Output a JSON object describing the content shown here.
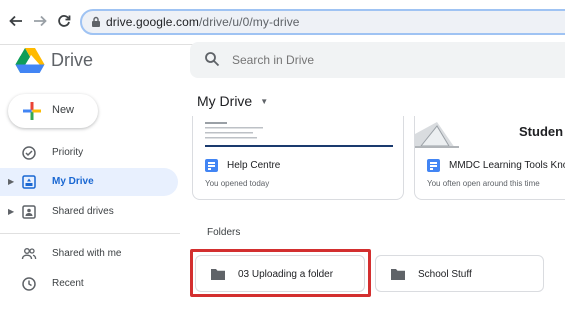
{
  "browser": {
    "url_host": "drive.google.com",
    "url_path": "/drive/u/0/my-drive",
    "back_icon": "arrow-left-icon",
    "forward_icon": "arrow-right-icon",
    "reload_icon": "reload-icon"
  },
  "header": {
    "brand": "Drive",
    "search_placeholder": "Search in Drive"
  },
  "sidebar": {
    "new_label": "New",
    "items": [
      {
        "label": "Priority",
        "icon": "check-circle-icon",
        "active": false,
        "caret": false
      },
      {
        "label": "My Drive",
        "icon": "my-drive-icon",
        "active": true,
        "caret": true
      },
      {
        "label": "Shared drives",
        "icon": "shared-drives-icon",
        "active": false,
        "caret": true
      },
      {
        "label": "Shared with me",
        "icon": "people-icon",
        "active": false,
        "caret": false
      },
      {
        "label": "Recent",
        "icon": "clock-icon",
        "active": false,
        "caret": false
      }
    ]
  },
  "main": {
    "title": "My Drive",
    "suggested": [
      {
        "name": "Help Centre",
        "subtitle": "You opened today"
      },
      {
        "name": "MMDC Learning Tools Know",
        "subtitle": "You often open around this time",
        "thumb_text": "Studen"
      }
    ],
    "folders_label": "Folders",
    "folders": [
      {
        "name": "03 Uploading a folder",
        "highlighted": true
      },
      {
        "name": "School Stuff",
        "highlighted": false
      }
    ]
  },
  "colors": {
    "accent": "#1967d2",
    "active_bg": "#e8f0fe",
    "highlight_border": "#d32f2f"
  }
}
